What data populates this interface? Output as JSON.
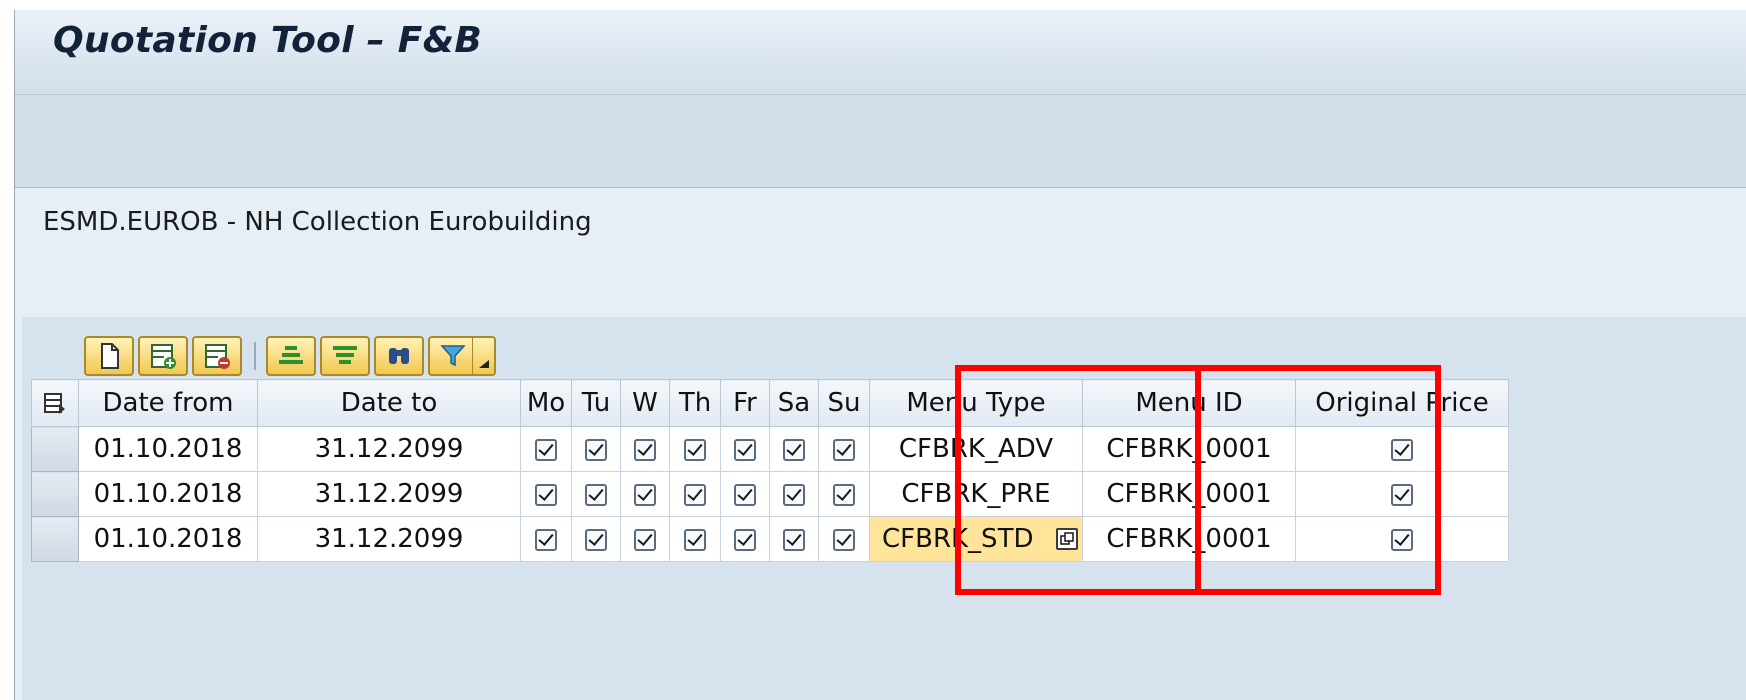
{
  "window": {
    "title": "Quotation Tool – F&B"
  },
  "hotel": {
    "label": "ESMD.EUROB - NH Collection Eurobuilding"
  },
  "grid_toolbar": {
    "buttons": [
      "new-document-icon",
      "insert-row-icon",
      "delete-row-icon",
      "sort-ascending-icon",
      "sort-descending-icon",
      "find-icon",
      "filter-icon"
    ]
  },
  "table": {
    "columns": [
      "Date from",
      "Date to",
      "Mo",
      "Tu",
      "W",
      "Th",
      "Fr",
      "Sa",
      "Su",
      "Menu Type",
      "Menu ID",
      "Original Price"
    ],
    "rows": [
      {
        "date_from": "01.10.2018",
        "date_to": "31.12.2099",
        "days": [
          true,
          true,
          true,
          true,
          true,
          true,
          true
        ],
        "menu_type": "CFBRK_ADV",
        "menu_id": "CFBRK_0001",
        "original_price": true
      },
      {
        "date_from": "01.10.2018",
        "date_to": "31.12.2099",
        "days": [
          true,
          true,
          true,
          true,
          true,
          true,
          true
        ],
        "menu_type": "CFBRK_PRE",
        "menu_id": "CFBRK_0001",
        "original_price": true
      },
      {
        "date_from": "01.10.2018",
        "date_to": "31.12.2099",
        "days": [
          true,
          true,
          true,
          true,
          true,
          true,
          true
        ],
        "menu_type": "CFBRK_STD",
        "menu_id": "CFBRK_0001",
        "original_price": true
      }
    ]
  },
  "colors": {
    "highlight": "#ff0000",
    "active_cell": "#ffe49a",
    "toolbar_button": "#f2c84e",
    "background": "#e6eef6"
  }
}
